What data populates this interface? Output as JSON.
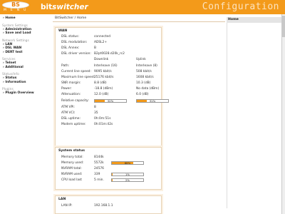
{
  "header": {
    "logo": "BS",
    "menu_letters": "MENU",
    "brand_plain": "bit",
    "brand_italic": "switcher",
    "config_title": "Configuration"
  },
  "nav": {
    "home": "› Home",
    "system_heading": "System Settings",
    "system_items": [
      "› Administration",
      "› Save and Load"
    ],
    "network_heading": "Network Settings",
    "network_items": [
      "› LAN",
      "› DSL WAN",
      "› DERT test"
    ],
    "services_heading": "Services",
    "services_items": [
      "› Telnet",
      "› Additional"
    ],
    "status_heading": "Status/Info",
    "status_items": [
      "› Status",
      "› Information"
    ],
    "plugins_heading": "Plugins",
    "plugins_items": [
      "› Plugin Overview"
    ]
  },
  "breadcrumb": "BitSwitcher / Home",
  "wan": {
    "title": "WAN",
    "dsl_status_label": "DSL status:",
    "dsl_status": "connected",
    "dsl_mod_label": "DSL modulation:",
    "dsl_mod": "ADSL2+",
    "dsl_annex_label": "DSL Annex:",
    "dsl_annex": "B",
    "dsl_driver_label": "DSL driver version:",
    "dsl_driver": "B2pt0028.d20k_rc2",
    "col_down": "Downlink",
    "col_up": "Uplink",
    "rows": [
      {
        "label": "Path:",
        "down": "Interleave (16)",
        "up": "Interleave (8)"
      },
      {
        "label": "Current line speed:",
        "down": "9095 kbit/s",
        "up": "508 kbit/s"
      },
      {
        "label": "Maximum line speed:",
        "down": "25176 kbit/s",
        "up": "1608 kbit/s"
      },
      {
        "label": "SNR margin:",
        "down": "8.8 (dB)",
        "up": "10.3 (dB)"
      },
      {
        "label": "Power:",
        "down": "-18.8 (dBm)",
        "up": "No data (dBm)"
      },
      {
        "label": "Attenuation:",
        "down": "12.0 (dB)",
        "up": "6.0 (dB)"
      }
    ],
    "rel_cap_label": "Relative capacity:",
    "rel_cap_down": 32,
    "rel_cap_down_text": "32%",
    "rel_cap_up": 31,
    "rel_cap_up_text": "31%",
    "atm_vpi_label": "ATM VPI:",
    "atm_vpi": "8",
    "atm_vci_label": "ATM VCI:",
    "atm_vci": "35",
    "dsl_uptime_label": "DSL uptime:",
    "dsl_uptime": "0h:0m:51s",
    "modem_uptime_label": "Modem uptime:",
    "modem_uptime": "0h:01m:42s"
  },
  "system": {
    "title": "System status",
    "mem_total_label": "Memory total:",
    "mem_total": "8144k",
    "mem_used_label": "Memory used:",
    "mem_used": "5572k",
    "mem_used_pct": 68,
    "mem_used_pct_text": "68%",
    "nvram_total_label": "NVRAM total:",
    "nvram_total": "24576",
    "nvram_used_label": "NVRAM used:",
    "nvram_used": "339",
    "nvram_used_pct": 1,
    "nvram_used_pct_text": "1%",
    "cpu_label": "CPU load last",
    "cpu_period": "5 min.",
    "cpu_pct": 2,
    "cpu_pct_text": "2%"
  },
  "lan": {
    "title": "LAN",
    "ip_label": "LAN IP:",
    "ip": "192.168.1.1"
  },
  "right": {
    "home_label": "Home"
  }
}
